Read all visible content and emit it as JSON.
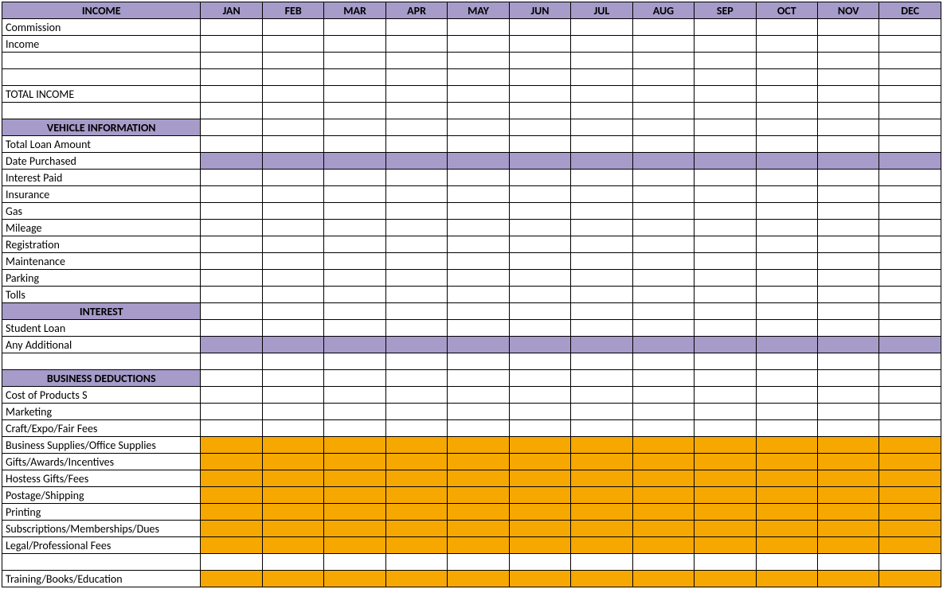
{
  "headers": {
    "main": "INCOME",
    "months": [
      "JAN",
      "FEB",
      "MAR",
      "APR",
      "MAY",
      "JUN",
      "JUL",
      "AUG",
      "SEP",
      "OCT",
      "NOV",
      "DEC"
    ]
  },
  "rows": [
    {
      "label": "Commission",
      "style": ""
    },
    {
      "label": "Income",
      "style": ""
    },
    {
      "label": "",
      "style": ""
    },
    {
      "label": "",
      "style": ""
    },
    {
      "label": "TOTAL INCOME",
      "style": ""
    },
    {
      "label": "",
      "style": ""
    },
    {
      "label": "VEHICLE INFORMATION",
      "style": "section"
    },
    {
      "label": "Total Loan Amount",
      "style": ""
    },
    {
      "label": "Date Purchased",
      "style": "purple"
    },
    {
      "label": "Interest Paid",
      "style": ""
    },
    {
      "label": "Insurance",
      "style": ""
    },
    {
      "label": "Gas",
      "style": ""
    },
    {
      "label": "Mileage",
      "style": ""
    },
    {
      "label": "Registration",
      "style": ""
    },
    {
      "label": "Maintenance",
      "style": ""
    },
    {
      "label": "Parking",
      "style": ""
    },
    {
      "label": "Tolls",
      "style": ""
    },
    {
      "label": "INTEREST",
      "style": "section"
    },
    {
      "label": "Student Loan",
      "style": ""
    },
    {
      "label": "Any Additional",
      "style": "purple"
    },
    {
      "label": "",
      "style": ""
    },
    {
      "label": "BUSINESS DEDUCTIONS",
      "style": "section"
    },
    {
      "label": "Cost of Products S",
      "style": ""
    },
    {
      "label": "Marketing",
      "style": ""
    },
    {
      "label": "Craft/Expo/Fair Fees",
      "style": ""
    },
    {
      "label": "Business Supplies/Office Supplies",
      "style": "orange"
    },
    {
      "label": "Gifts/Awards/Incentives",
      "style": "orange"
    },
    {
      "label": "Hostess Gifts/Fees",
      "style": "orange"
    },
    {
      "label": "Postage/Shipping",
      "style": "orange"
    },
    {
      "label": "Printing",
      "style": "orange"
    },
    {
      "label": "Subscriptions/Memberships/Dues",
      "style": "orange"
    },
    {
      "label": "Legal/Professional Fees",
      "style": "orange"
    },
    {
      "label": "",
      "style": ""
    },
    {
      "label": "Training/Books/Education",
      "style": "orange"
    }
  ]
}
